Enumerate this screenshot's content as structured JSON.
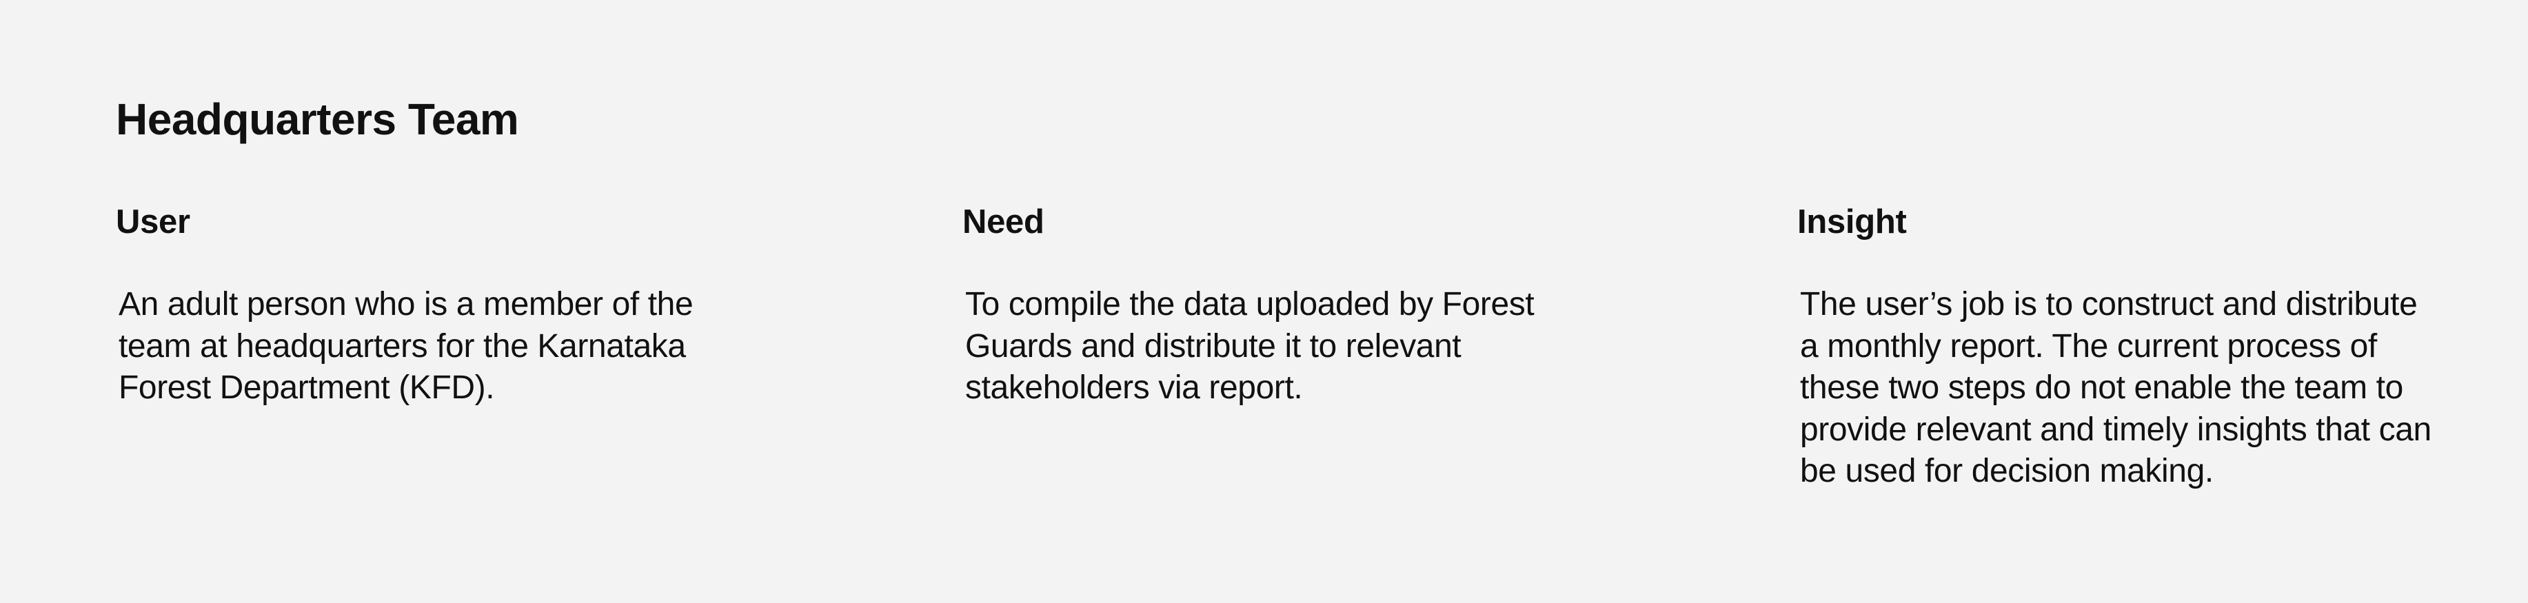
{
  "page": {
    "title": "Headquarters Team"
  },
  "columns": [
    {
      "heading": "User",
      "body": "An adult person who is a member of the\nteam at headquarters for the Karnataka\nForest Department (KFD)."
    },
    {
      "heading": "Need",
      "body": "To compile the data uploaded by Forest\nGuards and distribute it to relevant\nstakeholders via report."
    },
    {
      "heading": "Insight",
      "body": "The user’s job is to construct and distribute\na monthly report. The current process of\nthese two steps do not enable the team to\nprovide relevant and timely insights that can\nbe used for decision making."
    }
  ],
  "colors": {
    "background": "#f3f3f3",
    "text": "#111111"
  }
}
